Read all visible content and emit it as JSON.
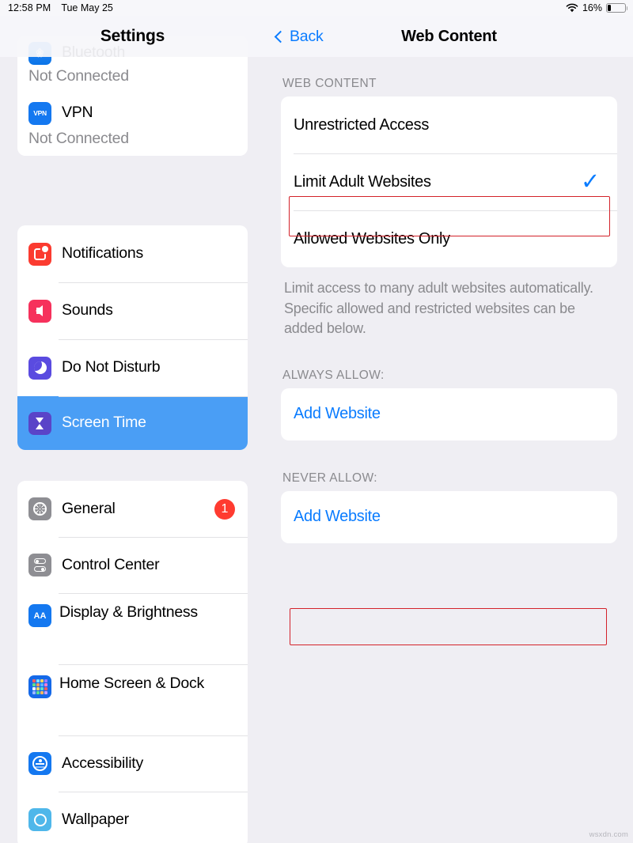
{
  "status_bar": {
    "time": "12:58 PM",
    "date": "Tue May 25",
    "battery_percent": "16%",
    "wifi_icon": "wifi-icon",
    "battery_icon": "battery-icon",
    "battery_level": 16
  },
  "sidebar": {
    "title": "Settings",
    "groups": [
      {
        "items": [
          {
            "label": "Bluetooth",
            "sub": "Not Connected",
            "icon": "bluetooth-icon",
            "selected": false,
            "badge": null
          },
          {
            "label": "VPN",
            "sub": "Not Connected",
            "icon": "vpn-icon",
            "selected": false,
            "badge": null
          }
        ]
      },
      {
        "items": [
          {
            "label": "Notifications",
            "sub": null,
            "icon": "notifications-icon",
            "selected": false,
            "badge": null
          },
          {
            "label": "Sounds",
            "sub": null,
            "icon": "sounds-icon",
            "selected": false,
            "badge": null
          },
          {
            "label": "Do Not Disturb",
            "sub": null,
            "icon": "do-not-disturb-icon",
            "selected": false,
            "badge": null
          },
          {
            "label": "Screen Time",
            "sub": null,
            "icon": "screen-time-icon",
            "selected": true,
            "badge": null
          }
        ]
      },
      {
        "items": [
          {
            "label": "General",
            "sub": null,
            "icon": "general-gear-icon",
            "selected": false,
            "badge": "1"
          },
          {
            "label": "Control Center",
            "sub": null,
            "icon": "control-center-icon",
            "selected": false,
            "badge": null
          },
          {
            "label": "Display & Brightness",
            "sub": null,
            "icon": "display-brightness-icon",
            "selected": false,
            "badge": null
          },
          {
            "label": "Home Screen & Dock",
            "sub": null,
            "icon": "home-screen-dock-icon",
            "selected": false,
            "badge": null
          },
          {
            "label": "Accessibility",
            "sub": null,
            "icon": "accessibility-icon",
            "selected": false,
            "badge": null
          },
          {
            "label": "Wallpaper",
            "sub": null,
            "icon": "wallpaper-icon",
            "selected": false,
            "badge": null
          }
        ]
      }
    ]
  },
  "detail": {
    "back_label": "Back",
    "back_icon": "chevron-left-icon",
    "title": "Web Content",
    "web_content_section": {
      "header": "WEB CONTENT",
      "options": [
        {
          "label": "Unrestricted Access",
          "checked": false
        },
        {
          "label": "Limit Adult Websites",
          "checked": true
        },
        {
          "label": "Allowed Websites Only",
          "checked": false
        }
      ],
      "checkmark_icon": "checkmark-icon",
      "note": "Limit access to many adult websites automatically. Specific allowed and restricted websites can be added below."
    },
    "always_allow_section": {
      "header": "ALWAYS ALLOW:",
      "add_label": "Add Website"
    },
    "never_allow_section": {
      "header": "NEVER ALLOW:",
      "add_label": "Add Website"
    }
  },
  "annotations": {
    "highlight_color": "#D3222A",
    "targets": [
      "Limit Adult Websites",
      "Add Website (Never Allow)"
    ]
  },
  "watermark": "wsxdn.com",
  "colors": {
    "accent_blue": "#0A7CFF",
    "selection_blue": "#4A9EF5",
    "badge_red": "#FF3B30",
    "annotation_red": "#D3222A",
    "page_bg": "#EFEEF3"
  }
}
